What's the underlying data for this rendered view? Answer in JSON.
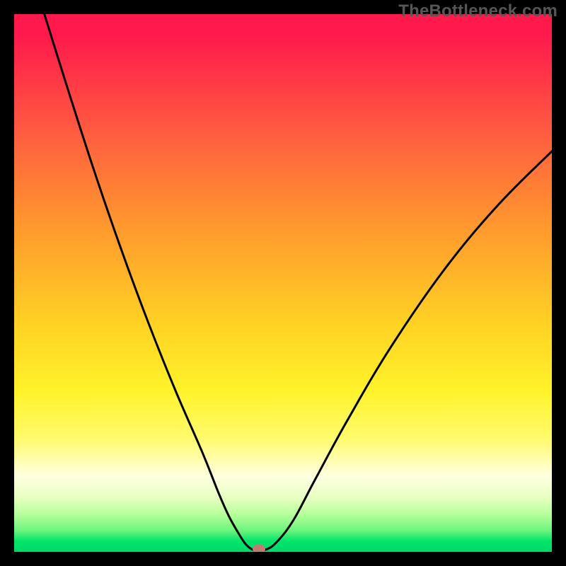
{
  "watermark": "TheBottleneck.com",
  "chart_data": {
    "type": "line",
    "title": "",
    "xlabel": "",
    "ylabel": "",
    "xlim": [
      0,
      100
    ],
    "ylim": [
      0,
      100
    ],
    "grid": false,
    "background": "red-yellow-green vertical gradient",
    "series": [
      {
        "name": "bottleneck-curve",
        "x": [
          0,
          5,
          10,
          15,
          20,
          25,
          30,
          35,
          38,
          40,
          42,
          43,
          44,
          45,
          47,
          49,
          52,
          56,
          62,
          70,
          80,
          90,
          100
        ],
        "y": [
          118,
          102,
          86,
          70.5,
          56,
          42.5,
          30,
          18.5,
          11,
          6.5,
          3,
          1.5,
          0.6,
          0.3,
          0.5,
          2,
          6,
          13.5,
          24.5,
          38,
          52.5,
          64.5,
          74.5
        ]
      }
    ],
    "annotations": [
      {
        "type": "marker",
        "shape": "rounded-dot",
        "x": 45.5,
        "y": 0.5,
        "color": "#c37a72"
      }
    ],
    "curve_min_x": 45.0
  },
  "colors": {
    "curve": "#000000",
    "marker": "#c37a72",
    "watermark": "#565656"
  }
}
